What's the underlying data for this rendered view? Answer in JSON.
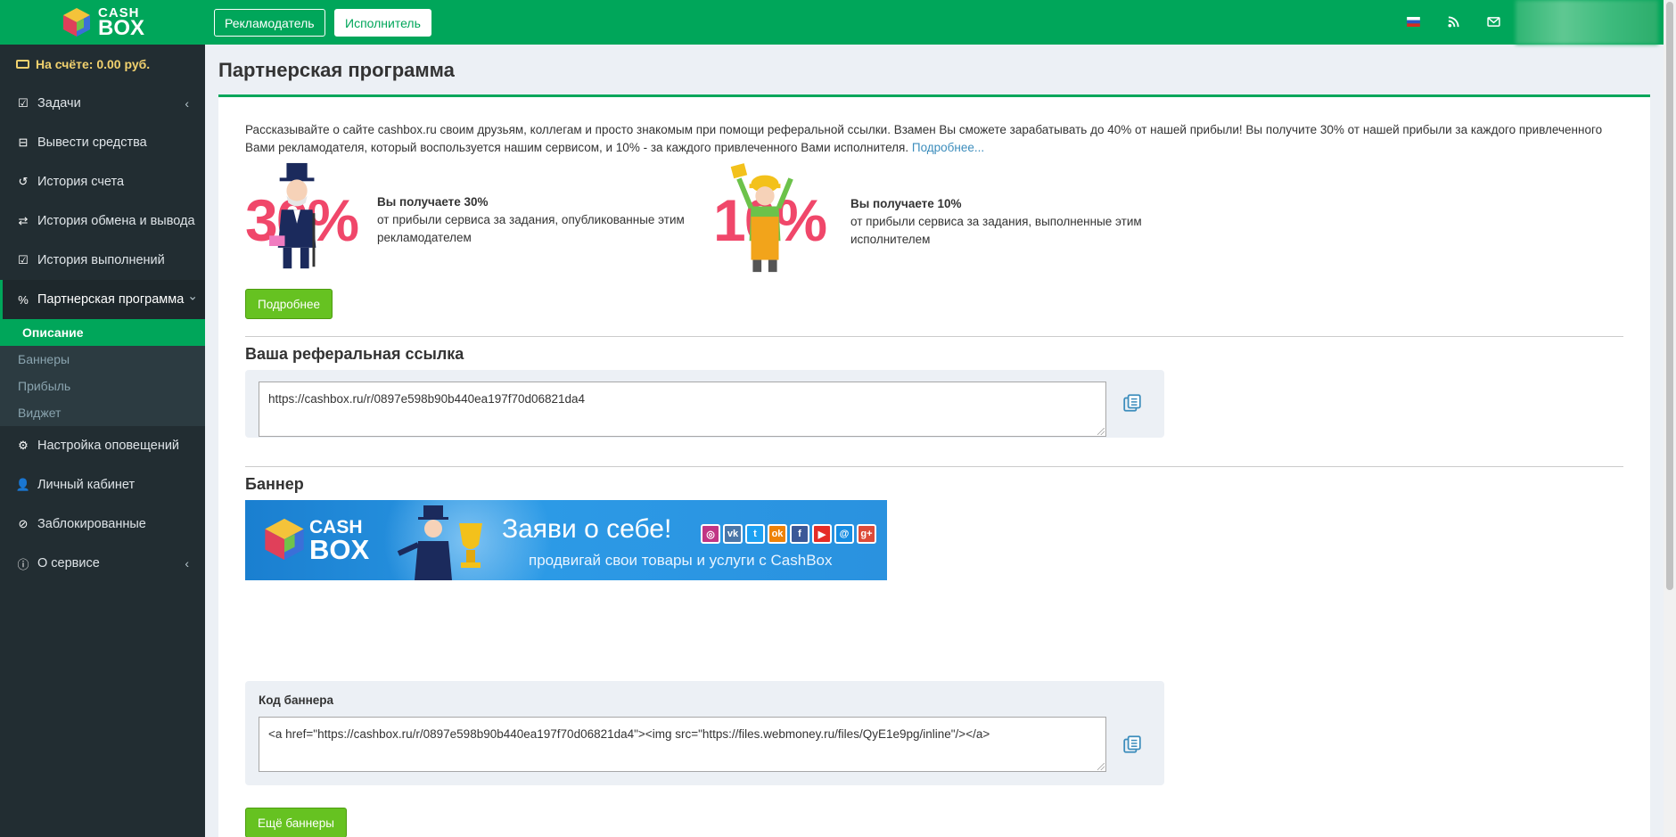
{
  "brand": {
    "line1": "CASH",
    "line2": "BOX"
  },
  "sidebar": {
    "balance": "На счёте: 0.00 руб.",
    "items": [
      {
        "label": "Задачи",
        "icon": "check-square-icon",
        "chevron": "‹"
      },
      {
        "label": "Вывести средства",
        "icon": "minus-square-icon"
      },
      {
        "label": "История счета",
        "icon": "history-icon"
      },
      {
        "label": "История обмена и вывода",
        "icon": "exchange-icon"
      },
      {
        "label": "История выполнений",
        "icon": "checklist-icon"
      },
      {
        "label": "Партнерская программа",
        "icon": "percent-icon",
        "chevron": "⌄"
      },
      {
        "label": "Настройка оповещений",
        "icon": "gears-icon"
      },
      {
        "label": "Личный кабинет",
        "icon": "user-icon"
      },
      {
        "label": "Заблокированные",
        "icon": "ban-icon"
      },
      {
        "label": "О сервисе",
        "icon": "info-icon",
        "chevron": "‹"
      }
    ],
    "submenu": [
      "Описание",
      "Баннеры",
      "Прибыль",
      "Виджет"
    ]
  },
  "topbar": {
    "btn_advertiser": "Рекламодатель",
    "btn_executor": "Исполнитель",
    "icons": [
      "russia-flag-icon",
      "rss-icon",
      "envelope-icon"
    ]
  },
  "page": {
    "title": "Партнерская программа",
    "intro": "Рассказывайте о сайте cashbox.ru своим друзьям, коллегам и просто знакомым при помощи реферальной ссылки. Взамен Вы сможете зарабатывать до 40% от нашей прибыли! Вы получите 30% от нашей прибыли за каждого привлеченного Вами рекламодателя, который воспользуется нашим сервисом, и 10% - за каждого привлеченного Вами исполнителя.",
    "intro_link": "Подробнее...",
    "promo1": {
      "pct": "30%",
      "title": "Вы получаете 30%",
      "text": "от прибыли сервиса за задания, опубликованные этим рекламодателем"
    },
    "promo2": {
      "pct": "10%",
      "title": "Вы получаете 10%",
      "text": "от прибыли сервиса за задания, выполненные этим исполнителем"
    },
    "btn_more": "Подробнее",
    "ref_title": "Ваша реферальная ссылка",
    "ref_link": "https://cashbox.ru/r/0897e598b90b440ea197f70d06821da4",
    "banner_title": "Баннер",
    "banner": {
      "brand1": "CASH",
      "brand2": "BOX",
      "slogan": "Заяви о себе!",
      "sub": "продвигай свои товары и услуги с CashBox",
      "socials": [
        "instagram-icon",
        "vk-icon",
        "twitter-icon",
        "odnoklassniki-icon",
        "facebook-icon",
        "youtube-icon",
        "moimir-icon",
        "googleplus-icon"
      ]
    },
    "code_label": "Код баннера",
    "banner_code": "<a href=\"https://cashbox.ru/r/0897e598b90b440ea197f70d06821da4\"><img src=\"https://files.webmoney.ru/files/QyE1e9pg/inline\"/></a>",
    "btn_more_banners": "Ещё баннеры"
  },
  "colors": {
    "green": "#00a65a",
    "sidebar": "#222d32",
    "accent_pink": "#f0476a",
    "button_green": "#66c221"
  }
}
